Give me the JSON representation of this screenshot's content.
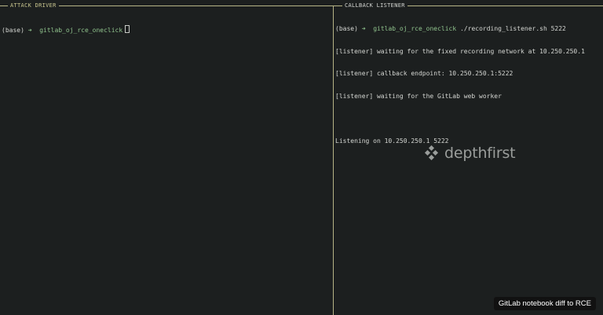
{
  "theme": {
    "background": "#1c1f1f",
    "text": "#d4d6d2",
    "accent_green": "#8fc28c",
    "border": "#b7b486",
    "caption_bg": "#111111"
  },
  "panes": {
    "left": {
      "title": "ATTACK DRIVER",
      "prompt": {
        "env": "(base)",
        "arrow": "➜",
        "dir": "gitlab_oj_rce_oneclick"
      }
    },
    "right": {
      "title": "CALLBACK LISTENER",
      "prompt": {
        "env": "(base)",
        "arrow": "➜",
        "dir": "gitlab_oj_rce_oneclick",
        "command": "./recording_listener.sh 5222"
      },
      "output": [
        "[listener] waiting for the fixed recording network at 10.250.250.1",
        "[listener] callback endpoint: 10.250.250.1:5222",
        "[listener] waiting for the GitLab web worker",
        "",
        "Listening on 10.250.250.1 5222"
      ]
    }
  },
  "watermark": {
    "text": "depthfirst",
    "icon": "depthfirst-logo-icon"
  },
  "caption": {
    "text": "GitLab notebook diff to RCE"
  }
}
